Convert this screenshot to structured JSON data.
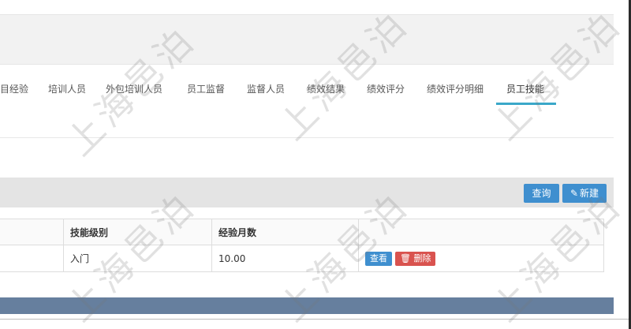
{
  "tabs": [
    {
      "label": "目经验"
    },
    {
      "label": "培训人员"
    },
    {
      "label": "外包培训人员"
    },
    {
      "label": "员工监督"
    },
    {
      "label": "监督人员"
    },
    {
      "label": "绩效结果"
    },
    {
      "label": "绩效评分"
    },
    {
      "label": "绩效评分明细"
    },
    {
      "label": "员工技能",
      "active": true
    }
  ],
  "toolbar": {
    "query_label": "查询",
    "new_label": "新建",
    "new_icon": "pencil-icon"
  },
  "table": {
    "headers": [
      "",
      "技能级别",
      "经验月数",
      ""
    ],
    "rows": [
      {
        "cells": [
          "",
          "入门",
          "10.00"
        ],
        "view_label": "查看",
        "delete_label": "删除",
        "delete_icon": "trash-icon"
      }
    ]
  },
  "watermark": "上海邑泊",
  "colors": {
    "accent": "#3f8fcf",
    "danger": "#d9534f",
    "tab_underline": "#3aa8c9",
    "footer": "#667f9e"
  }
}
